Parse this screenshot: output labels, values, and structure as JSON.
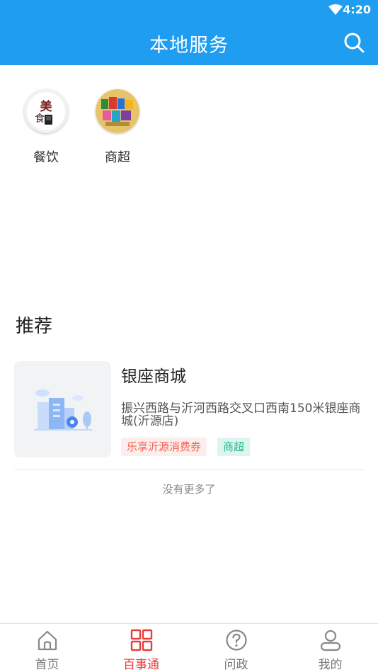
{
  "status_bar": {
    "time": "4:20"
  },
  "header": {
    "title": "本地服务"
  },
  "categories": [
    {
      "label": "餐饮",
      "icon": "food-icon"
    },
    {
      "label": "商超",
      "icon": "supermarket-icon"
    }
  ],
  "recommend": {
    "title": "推荐",
    "stores": [
      {
        "name": "银座商城",
        "address": "振兴西路与沂河西路交叉口西南150米银座商城(沂源店)",
        "tags": [
          "乐享沂源消费券",
          "商超"
        ]
      }
    ],
    "no_more": "没有更多了"
  },
  "tab_bar": {
    "items": [
      {
        "label": "首页",
        "icon": "home-icon"
      },
      {
        "label": "百事通",
        "icon": "grid-icon",
        "active": true
      },
      {
        "label": "问政",
        "icon": "question-icon"
      },
      {
        "label": "我的",
        "icon": "user-icon"
      }
    ]
  },
  "colors": {
    "primary": "#1e9df1",
    "active_tab": "#e83d3d",
    "tag_red": "#f25d4e",
    "tag_green": "#1fb58a"
  }
}
